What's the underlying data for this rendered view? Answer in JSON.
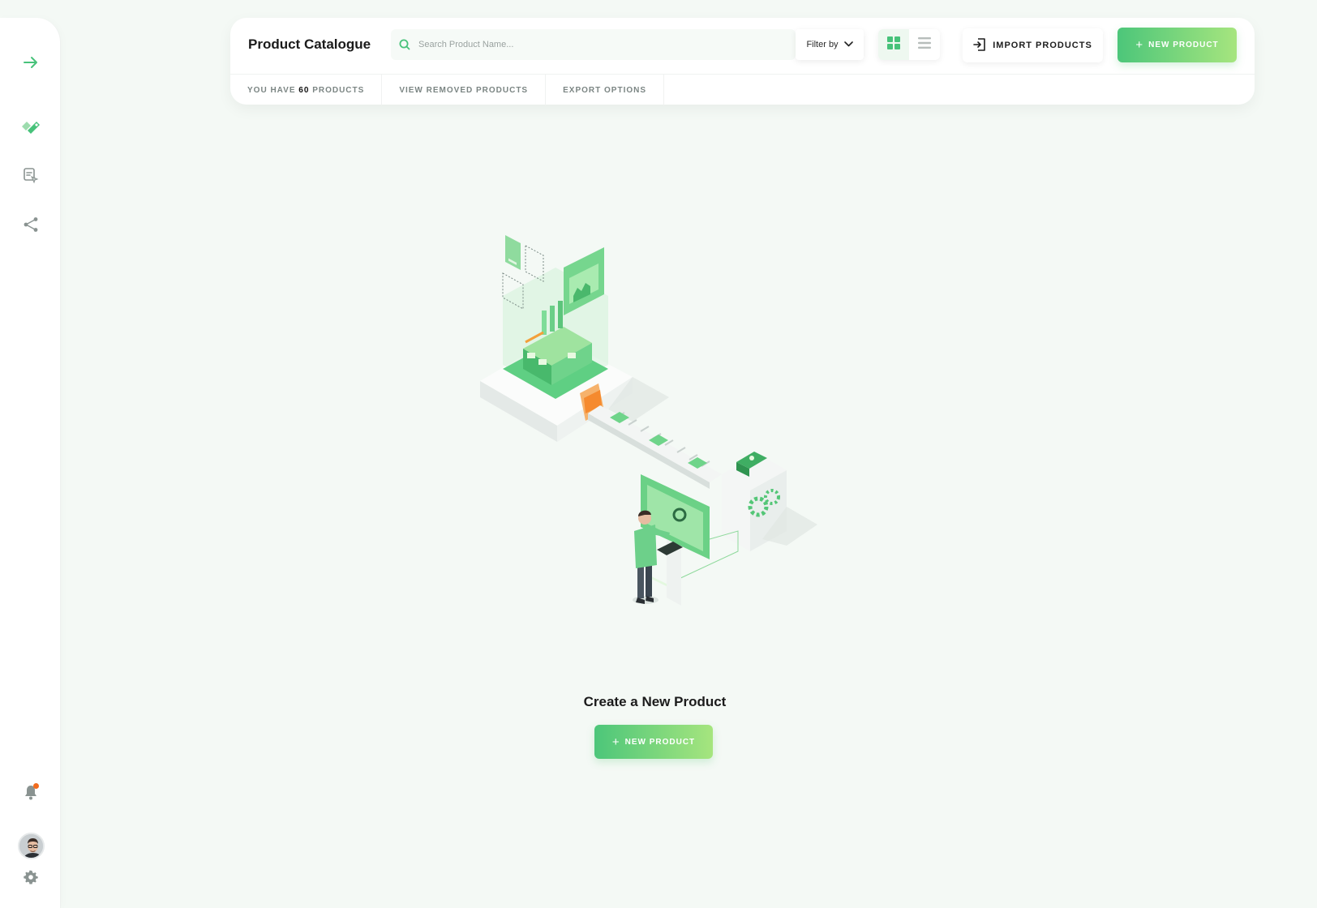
{
  "sidebar": {
    "icons": [
      "arrow-right-icon",
      "tag-icon",
      "form-cursor-icon",
      "share-icon",
      "bell-icon",
      "settings-icon"
    ],
    "notification_dot_color": "#f26b1d"
  },
  "header": {
    "title": "Product Catalogue",
    "search": {
      "placeholder": "Search Product Name...",
      "value": ""
    },
    "filter_label": "Filter by",
    "view_modes": {
      "active": "grid",
      "options": [
        "grid",
        "list"
      ]
    },
    "import_label": "IMPORT PRODUCTS",
    "new_product_label": "NEW PRODUCT",
    "tabs": {
      "count_prefix": "YOU HAVE",
      "count": "60",
      "count_suffix": "PRODUCTS",
      "removed": "VIEW REMOVED PRODUCTS",
      "export": "EXPORT OPTIONS"
    }
  },
  "empty_state": {
    "title": "Create a New Product",
    "button_label": "NEW PRODUCT"
  },
  "colors": {
    "accent_start": "#4cc67a",
    "accent_end": "#a6e57e",
    "background": "#f4f9f5"
  }
}
